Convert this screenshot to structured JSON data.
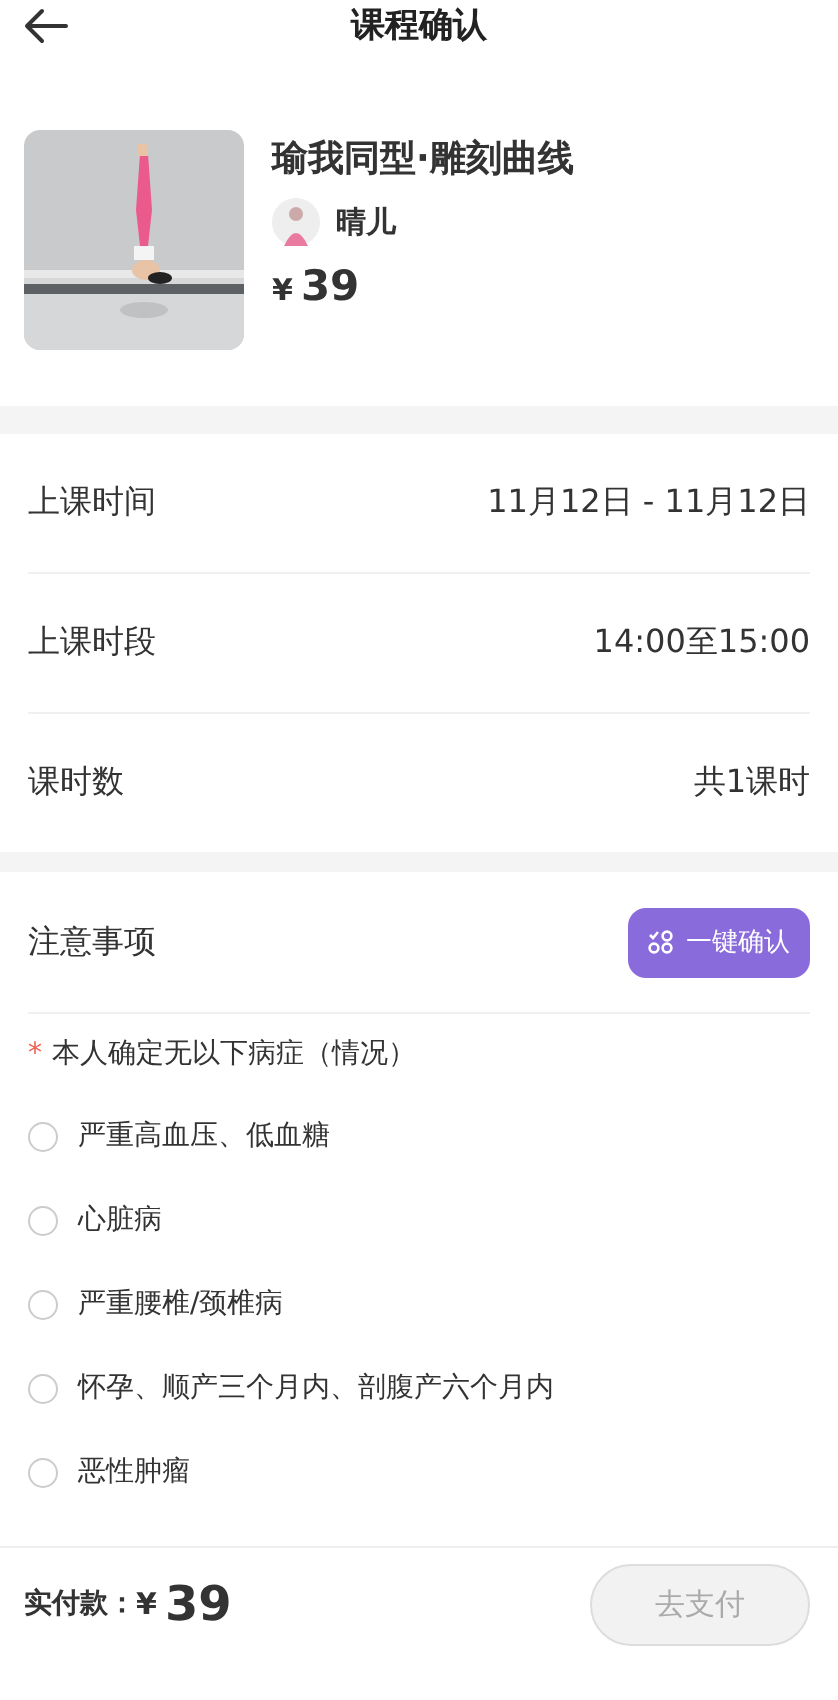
{
  "header": {
    "title": "课程确认"
  },
  "course": {
    "name": "瑜我同型·雕刻曲线",
    "teacher": "晴儿",
    "currency": "¥",
    "price": "39"
  },
  "info": [
    {
      "label": "上课时间",
      "value": "11月12日 - 11月12日"
    },
    {
      "label": "上课时段",
      "value": "14:00至15:00"
    },
    {
      "label": "课时数",
      "value": "共1课时"
    }
  ],
  "notice": {
    "title": "注意事项",
    "confirm_all": "一键确认",
    "required_mark": "*",
    "question": "本人确定无以下病症（情况）",
    "options": [
      {
        "label": "严重高血压、低血糖",
        "checked": false
      },
      {
        "label": "心脏病",
        "checked": false
      },
      {
        "label": "严重腰椎/颈椎病",
        "checked": false
      },
      {
        "label": "怀孕、顺产三个月内、剖腹产六个月内",
        "checked": false
      },
      {
        "label": "恶性肿瘤",
        "checked": false
      }
    ]
  },
  "footer": {
    "label": "实付款：",
    "currency": "¥",
    "amount": "39",
    "pay_button": {
      "label": "去支付",
      "disabled": true
    }
  }
}
